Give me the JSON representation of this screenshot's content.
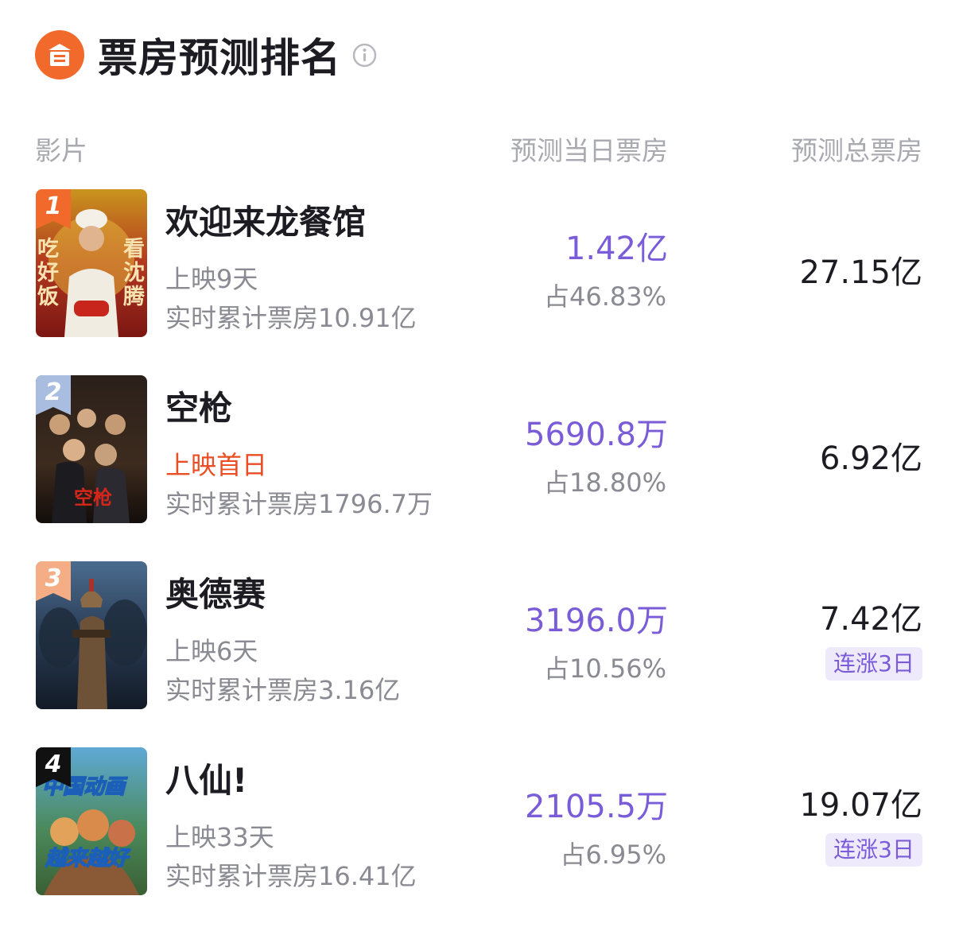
{
  "header": {
    "title": "票房预测排名"
  },
  "columns": {
    "film": "影片",
    "day_forecast": "预测当日票房",
    "total_forecast": "预测总票房"
  },
  "colors": {
    "accent": "#7a5cd8",
    "logo": "#f26a2b",
    "highlight_red": "#ea4e25",
    "rank1": "#f26a2b",
    "rank2": "#a8bde0",
    "rank3": "#f4ad84",
    "rank4": "#111111"
  },
  "movies": [
    {
      "rank": "1",
      "name": "欢迎来龙餐馆",
      "status": "上映9天",
      "cumulative": "实时累计票房10.91亿",
      "day_forecast": "1.42亿",
      "share": "占46.83%",
      "total_forecast": "27.15亿",
      "badge": "",
      "poster_text_left": "吃好饭",
      "poster_text_right": "看沈腾"
    },
    {
      "rank": "2",
      "name": "空枪",
      "status": "上映首日",
      "cumulative": "实时累计票房1796.7万",
      "day_forecast": "5690.8万",
      "share": "占18.80%",
      "total_forecast": "6.92亿",
      "badge": "",
      "poster_text": "空枪"
    },
    {
      "rank": "3",
      "name": "奥德赛",
      "status": "上映6天",
      "cumulative": "实时累计票房3.16亿",
      "day_forecast": "3196.0万",
      "share": "占10.56%",
      "total_forecast": "7.42亿",
      "badge": "连涨3日"
    },
    {
      "rank": "4",
      "name": "八仙!",
      "status": "上映33天",
      "cumulative": "实时累计票房16.41亿",
      "day_forecast": "2105.5万",
      "share": "占6.95%",
      "total_forecast": "19.07亿",
      "badge": "连涨3日",
      "poster_text_top": "中国动画",
      "poster_text_bottom": "越来越好"
    }
  ]
}
